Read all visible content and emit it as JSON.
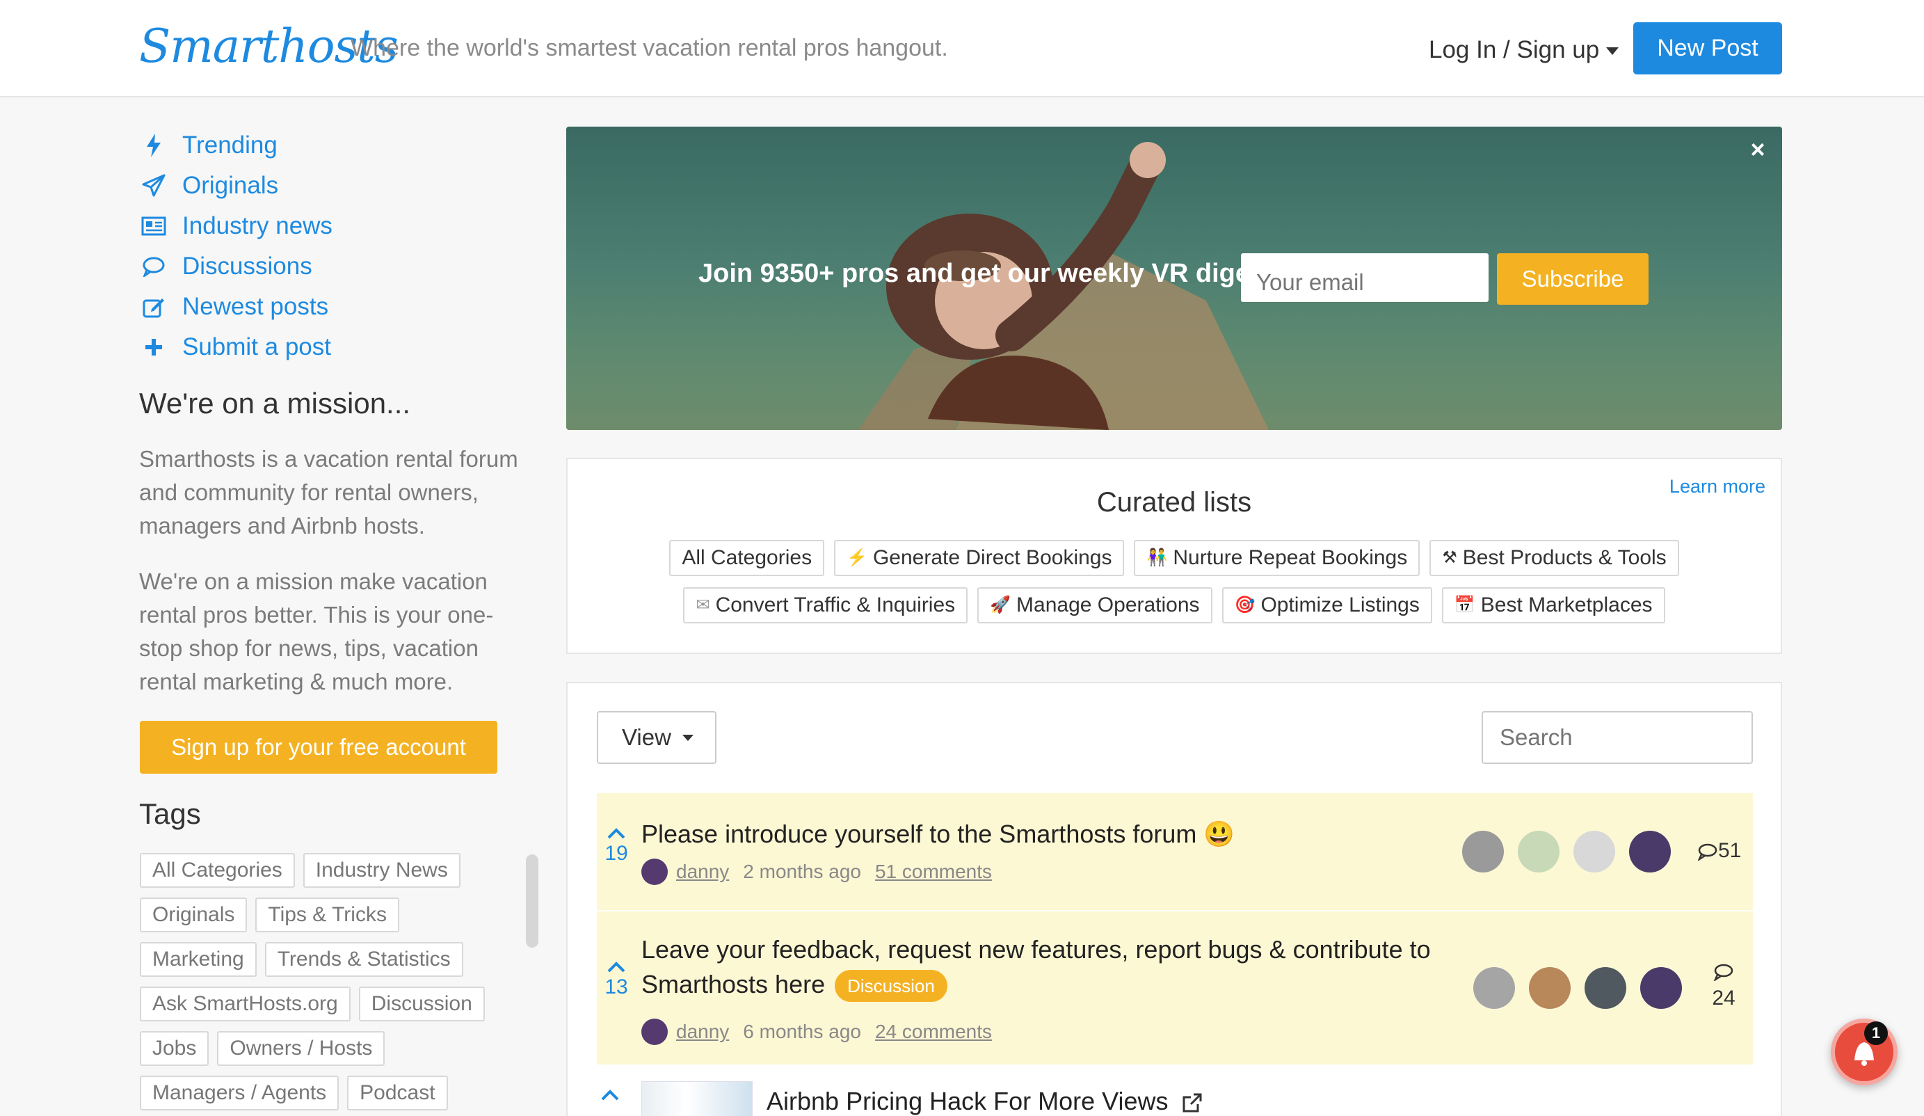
{
  "header": {
    "logo": "Smarthosts",
    "tagline": "Where the world's smartest vacation rental pros hangout.",
    "login_label": "Log In / Sign up",
    "new_post_label": "New Post"
  },
  "sidebar": {
    "nav": [
      {
        "label": "Trending",
        "icon": "bolt-icon"
      },
      {
        "label": "Originals",
        "icon": "paper-plane-icon"
      },
      {
        "label": "Industry news",
        "icon": "newspaper-icon"
      },
      {
        "label": "Discussions",
        "icon": "chat-bubble-icon"
      },
      {
        "label": "Newest posts",
        "icon": "edit-icon"
      },
      {
        "label": "Submit a post",
        "icon": "plus-icon"
      }
    ],
    "mission_title": "We're on a mission...",
    "mission_p1": "Smarthosts is a vacation rental forum and community for rental owners, managers and Airbnb hosts.",
    "mission_p2": "We're on a mission make vacation rental pros better. This is your one-stop shop for news, tips, vacation rental marketing & much more.",
    "signup_label": "Sign up for your free account",
    "tags_title": "Tags",
    "tags": [
      [
        "All Categories",
        "Industry News"
      ],
      [
        "Originals",
        "Tips & Tricks"
      ],
      [
        "Marketing",
        "Trends & Statistics"
      ],
      [
        "Ask SmartHosts.org",
        "Discussion"
      ],
      [
        "Jobs",
        "Owners / Hosts"
      ],
      [
        "Managers / Agents",
        "Podcast"
      ]
    ]
  },
  "hero": {
    "title": "Join 9350+ pros and get our weekly VR digest",
    "email_placeholder": "Your email",
    "subscribe_label": "Subscribe",
    "close_label": "×"
  },
  "curated": {
    "learn_more": "Learn more",
    "title": "Curated lists",
    "row1": [
      {
        "emoji": "",
        "label": "All Categories"
      },
      {
        "emoji": "⚡",
        "label": "Generate Direct Bookings"
      },
      {
        "emoji": "👫",
        "label": "Nurture Repeat Bookings"
      },
      {
        "emoji": "⚒",
        "label": "Best Products & Tools"
      }
    ],
    "row2": [
      {
        "emoji": "✉",
        "label": "Convert Traffic & Inquiries"
      },
      {
        "emoji": "🚀",
        "label": "Manage Operations"
      },
      {
        "emoji": "🎯",
        "label": "Optimize Listings"
      },
      {
        "emoji": "📅",
        "label": "Best Marketplaces"
      }
    ]
  },
  "feed": {
    "view_label": "View",
    "search_placeholder": "Search",
    "posts": [
      {
        "votes": "19",
        "title": "Please introduce yourself to the Smarthosts forum",
        "title_emoji": "😃",
        "author": "danny",
        "age": "2 months ago",
        "comments_link": "51 comments",
        "comment_count": "51",
        "badge": ""
      },
      {
        "votes": "13",
        "title_line1": "Leave your feedback, request new features, report bugs & contribute to",
        "title_line2": "Smarthosts here",
        "badge": "Discussion",
        "author": "danny",
        "age": "6 months ago",
        "comments_link": "24 comments",
        "comment_count": "24"
      },
      {
        "title": "Airbnb Pricing Hack For More Views"
      }
    ]
  },
  "notification": {
    "count": "1"
  },
  "colors": {
    "brand_blue": "#1d8ae0",
    "accent_yellow": "#f4b223",
    "post_highlight": "#fdf8d4"
  }
}
